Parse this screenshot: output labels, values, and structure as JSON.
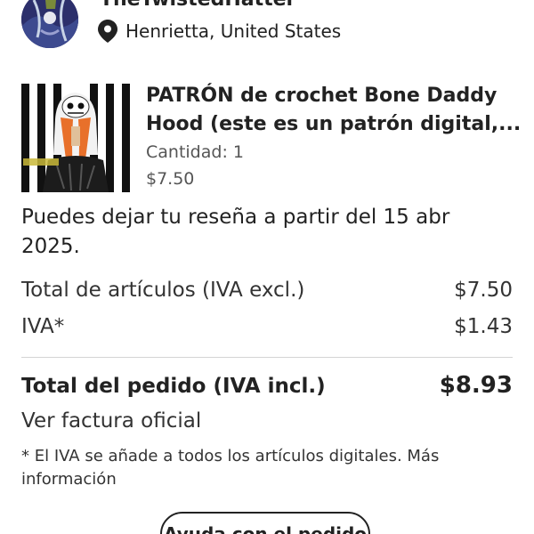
{
  "shop": {
    "name": "TheTwistedHatter",
    "location": "Henrietta, United States",
    "avatar_icon": "shop-avatar-image",
    "location_icon": "location-pin-icon"
  },
  "product": {
    "title_line1": "PATRÓN de crochet Bone Daddy",
    "title_line2": "Hood (este es un patrón digital,...",
    "quantity": "Cantidad: 1",
    "price": "$7.50",
    "thumbnail_icon": "product-thumbnail-image"
  },
  "review_notice": "Puedes dejar tu reseña a partir del 15 abr 2025.",
  "summary": {
    "items_label": "Total de artículos (IVA excl.)",
    "items_value": "$7.50",
    "tax_label": "IVA*",
    "tax_value": "$1.43",
    "total_label": "Total del pedido (IVA incl.)",
    "total_value": "$8.93"
  },
  "invoice_link": "Ver factura oficial",
  "vat_note": "* El IVA se añade a todos los artículos digitales. Más información",
  "help_button": "Ayuda con el pedido"
}
